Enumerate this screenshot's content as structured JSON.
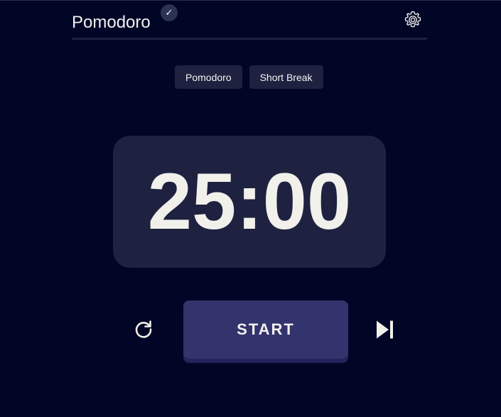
{
  "header": {
    "title": "Pomodoro",
    "badge_icon": "check-icon",
    "badge_glyph": "✓",
    "settings_icon": "gear-icon"
  },
  "tabs": [
    {
      "label": "Pomodoro"
    },
    {
      "label": "Short Break"
    }
  ],
  "timer": {
    "display": "25:00"
  },
  "controls": {
    "reset_icon": "reset-icon",
    "start_label": "START",
    "skip_icon": "skip-next-icon"
  },
  "colors": {
    "background": "#010526",
    "card": "#1e2240",
    "button": "#33336e",
    "text": "#f2f0eb"
  }
}
